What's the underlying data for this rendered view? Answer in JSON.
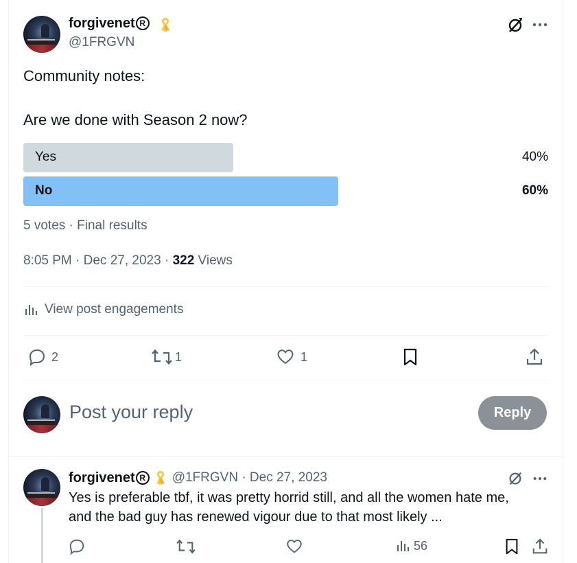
{
  "post": {
    "author_name": "forgivenet",
    "registered_mark": "R",
    "handle": "@1FRGVN",
    "line1": "Community notes:",
    "question": "Are we done with Season 2 now?",
    "poll": {
      "options": [
        {
          "label": "Yes",
          "percent_text": "40%",
          "percent": 40,
          "color": "#cfd9de",
          "winner": false
        },
        {
          "label": "No",
          "percent_text": "60%",
          "percent": 60,
          "color": "#81c1f5",
          "winner": true
        }
      ],
      "summary": "5 votes · Final results"
    },
    "meta_time": "8:05 PM · Dec 27, 2023 · ",
    "views_count": "322",
    "views_label": " Views",
    "engagements_link": "View post engagements",
    "actions": {
      "replies": "2",
      "reposts": "1",
      "likes": "1"
    }
  },
  "composer": {
    "placeholder": "Post your reply",
    "button_label": "Reply"
  },
  "reply": {
    "author_name": "forgivenet",
    "registered_mark": "R",
    "handle_date": "@1FRGVN · Dec 27, 2023",
    "text_line1": "Yes is preferable tbf, it was pretty horrid still, and all the women hate me,",
    "text_line2": "and the bad guy has renewed vigour due to that most likely ...",
    "views": "56"
  },
  "colors": {
    "accent_ribbon": "#f7c948",
    "muted": "#536471",
    "button_disabled": "#8b9196"
  },
  "icons": [
    "ribbon-icon",
    "grok-icon",
    "more-icon",
    "analytics-icon",
    "reply-icon",
    "repost-icon",
    "like-icon",
    "bookmark-icon",
    "share-icon",
    "views-icon"
  ]
}
